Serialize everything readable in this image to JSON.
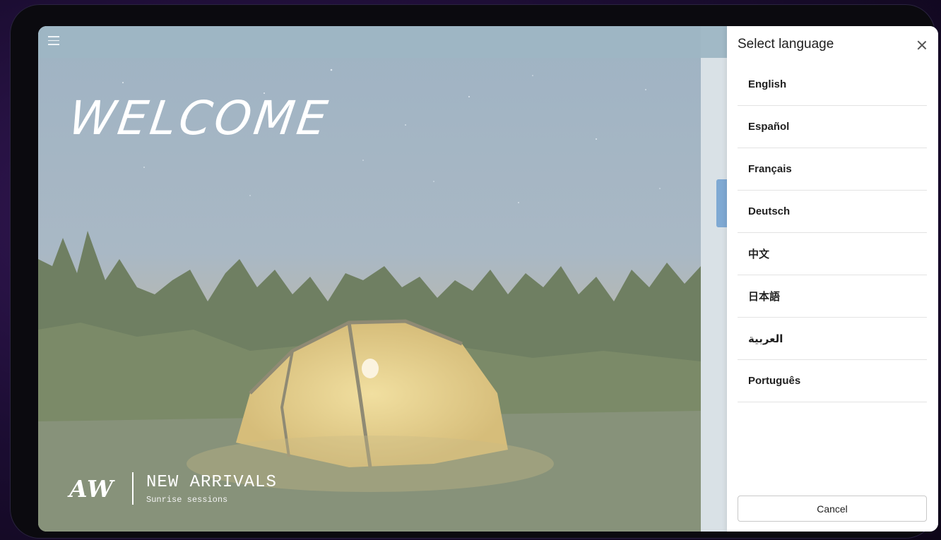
{
  "hero": {
    "welcome_text": "WELCOME",
    "logo": "AW",
    "title": "NEW ARRIVALS",
    "subtitle": "Sunrise sessions"
  },
  "panel": {
    "title": "Select language",
    "languages": [
      "English",
      "Español",
      "Français",
      "Deutsch",
      "中文",
      "日本語",
      "العربية",
      "Português"
    ],
    "cancel_label": "Cancel"
  },
  "icons": {
    "menu": "hamburger-menu-icon",
    "close": "close-icon"
  },
  "colors": {
    "topbar": "#9eb6c4",
    "accent": "#7fa9d3",
    "panel_bg": "#ffffff"
  }
}
